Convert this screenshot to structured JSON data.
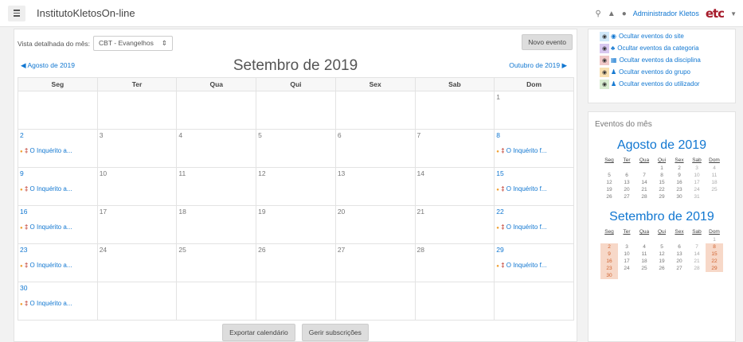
{
  "header": {
    "site_name": "InstitutoKletosOn-line",
    "user_name": "Administrador Kletos",
    "logo_text": "etc"
  },
  "toolbar": {
    "view_label": "Vista detalhada do mês:",
    "course_select": "CBT - Evangelhos",
    "new_event_label": "Novo evento"
  },
  "calendar": {
    "prev_month": "Agosto de 2019",
    "title": "Setembro de 2019",
    "next_month": "Outubro de 2019",
    "weekdays": [
      "Seg",
      "Ter",
      "Qua",
      "Qui",
      "Sex",
      "Sab",
      "Dom"
    ],
    "weeks": [
      [
        {
          "d": ""
        },
        {
          "d": ""
        },
        {
          "d": ""
        },
        {
          "d": ""
        },
        {
          "d": ""
        },
        {
          "d": ""
        },
        {
          "d": "1"
        }
      ],
      [
        {
          "d": "2",
          "e": "O Inquérito a..."
        },
        {
          "d": "3"
        },
        {
          "d": "4"
        },
        {
          "d": "5"
        },
        {
          "d": "6"
        },
        {
          "d": "7"
        },
        {
          "d": "8",
          "e": "O Inquérito f..."
        }
      ],
      [
        {
          "d": "9",
          "e": "O Inquérito a..."
        },
        {
          "d": "10"
        },
        {
          "d": "11"
        },
        {
          "d": "12"
        },
        {
          "d": "13"
        },
        {
          "d": "14"
        },
        {
          "d": "15",
          "e": "O Inquérito f..."
        }
      ],
      [
        {
          "d": "16",
          "e": "O Inquérito a..."
        },
        {
          "d": "17"
        },
        {
          "d": "18"
        },
        {
          "d": "19"
        },
        {
          "d": "20"
        },
        {
          "d": "21"
        },
        {
          "d": "22",
          "e": "O Inquérito f..."
        }
      ],
      [
        {
          "d": "23",
          "e": "O Inquérito a..."
        },
        {
          "d": "24"
        },
        {
          "d": "25"
        },
        {
          "d": "26"
        },
        {
          "d": "27"
        },
        {
          "d": "28"
        },
        {
          "d": "29",
          "e": "O Inquérito f..."
        }
      ],
      [
        {
          "d": "30",
          "e": "O Inquérito a..."
        },
        {
          "d": ""
        },
        {
          "d": ""
        },
        {
          "d": ""
        },
        {
          "d": ""
        },
        {
          "d": ""
        },
        {
          "d": ""
        }
      ]
    ],
    "export_label": "Exportar calendário",
    "subscriptions_label": "Gerir subscrições"
  },
  "legend": {
    "items": [
      {
        "label": "Ocultar eventos do site",
        "color": "#d0e8f8",
        "icon": "globe-icon"
      },
      {
        "label": "Ocultar eventos da categoria",
        "color": "#d8c8f0",
        "icon": "category-icon"
      },
      {
        "label": "Ocultar eventos da disciplina",
        "color": "#f0c8c8",
        "icon": "course-icon"
      },
      {
        "label": "Ocultar eventos do grupo",
        "color": "#f8e0b0",
        "icon": "group-icon"
      },
      {
        "label": "Ocultar eventos do utilizador",
        "color": "#d8ecd0",
        "icon": "user-icon"
      }
    ]
  },
  "month_block": {
    "title": "Eventos do mês",
    "weekdays": [
      "Seg",
      "Ter",
      "Qua",
      "Qui",
      "Sex",
      "Sab",
      "Dom"
    ],
    "months": [
      {
        "title": "Agosto de 2019",
        "weeks": [
          [
            "",
            "",
            "",
            "1",
            "2",
            "3",
            "4"
          ],
          [
            "5",
            "6",
            "7",
            "8",
            "9",
            "10",
            "11"
          ],
          [
            "12",
            "13",
            "14",
            "15",
            "16",
            "17",
            "18"
          ],
          [
            "19",
            "20",
            "21",
            "22",
            "23",
            "24",
            "25"
          ],
          [
            "26",
            "27",
            "28",
            "29",
            "30",
            "31",
            ""
          ]
        ],
        "event_days": []
      },
      {
        "title": "Setembro de 2019",
        "weeks": [
          [
            "",
            "",
            "",
            "",
            "",
            "",
            "1"
          ],
          [
            "2",
            "3",
            "4",
            "5",
            "6",
            "7",
            "8"
          ],
          [
            "9",
            "10",
            "11",
            "12",
            "13",
            "14",
            "15"
          ],
          [
            "16",
            "17",
            "18",
            "19",
            "20",
            "21",
            "22"
          ],
          [
            "23",
            "24",
            "25",
            "26",
            "27",
            "28",
            "29"
          ],
          [
            "30",
            "",
            "",
            "",
            "",
            "",
            ""
          ]
        ],
        "event_days": [
          "2",
          "8",
          "9",
          "15",
          "16",
          "22",
          "23",
          "29",
          "30"
        ]
      }
    ]
  }
}
